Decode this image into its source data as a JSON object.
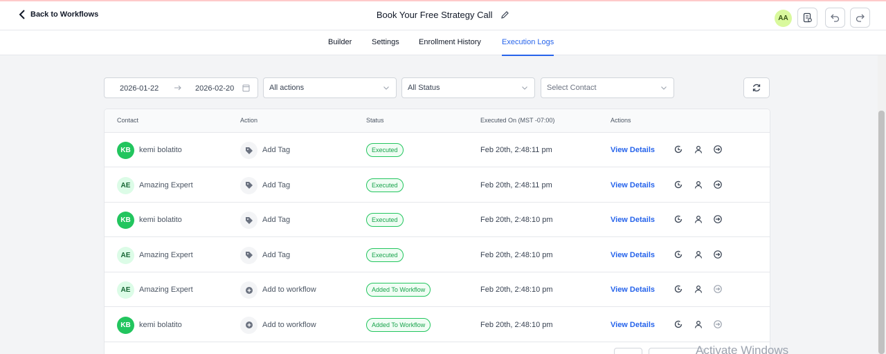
{
  "header": {
    "back_label": "Back to Workflows",
    "title": "Book Your Free Strategy Call",
    "user_initials": "AA"
  },
  "tabs": [
    {
      "label": "Builder"
    },
    {
      "label": "Settings"
    },
    {
      "label": "Enrollment History"
    },
    {
      "label": "Execution Logs",
      "active": true
    }
  ],
  "filters": {
    "date_start": "2026-01-22",
    "date_end": "2026-02-20",
    "actions_selected": "All actions",
    "status_selected": "All Status",
    "contact_placeholder": "Select Contact"
  },
  "table": {
    "columns": [
      "Contact",
      "Action",
      "Status",
      "Executed On (MST -07:00)",
      "Actions"
    ],
    "view_details_label": "View Details",
    "rows": [
      {
        "initials": "KB",
        "contact": "kemi bolatito",
        "action": "Add Tag",
        "status": "Executed",
        "executed_on": "Feb 20th, 2:48:11 pm"
      },
      {
        "initials": "AE",
        "contact": "Amazing Expert",
        "action": "Add Tag",
        "status": "Executed",
        "executed_on": "Feb 20th, 2:48:11 pm"
      },
      {
        "initials": "KB",
        "contact": "kemi bolatito",
        "action": "Add Tag",
        "status": "Executed",
        "executed_on": "Feb 20th, 2:48:10 pm"
      },
      {
        "initials": "AE",
        "contact": "Amazing Expert",
        "action": "Add Tag",
        "status": "Executed",
        "executed_on": "Feb 20th, 2:48:10 pm"
      },
      {
        "initials": "AE",
        "contact": "Amazing Expert",
        "action": "Add to workflow",
        "status": "Added To Workflow",
        "executed_on": "Feb 20th, 2:48:10 pm"
      },
      {
        "initials": "KB",
        "contact": "kemi bolatito",
        "action": "Add to workflow",
        "status": "Added To Workflow",
        "executed_on": "Feb 20th, 2:48:10 pm"
      }
    ]
  },
  "watermark": "Activate Windows",
  "colors": {
    "accent": "#2563eb",
    "success": "#22c55e",
    "avatar_top": "#d9f99d"
  }
}
